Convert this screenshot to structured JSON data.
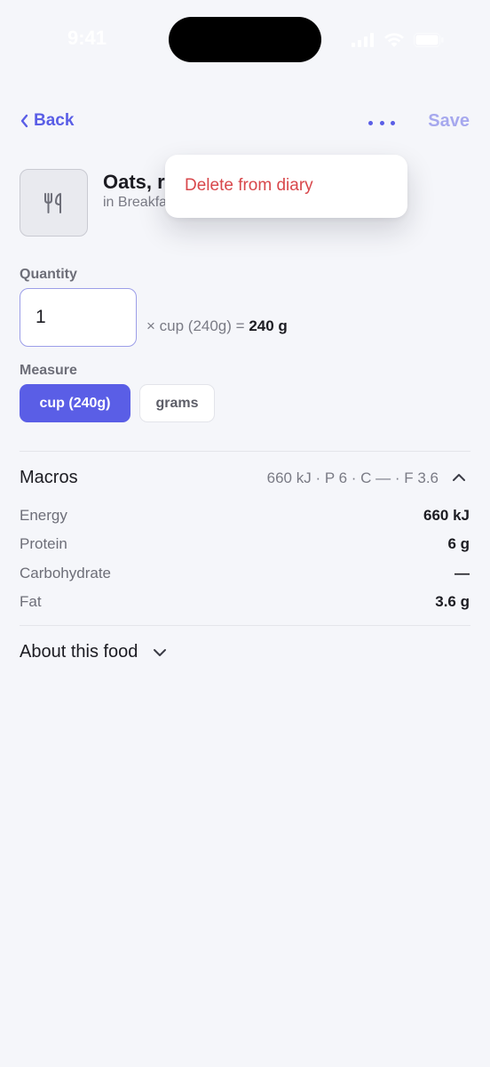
{
  "status_bar": {
    "time": "9:41"
  },
  "nav": {
    "back_label": "Back",
    "save_label": "Save"
  },
  "food": {
    "title": "Oats, r",
    "subtitle": "in Breakfa"
  },
  "menu": {
    "delete_label": "Delete from diary"
  },
  "quantity": {
    "label": "Quantity",
    "value": "1",
    "expr_prefix": "× cup (240g) =",
    "expr_total": "240 g"
  },
  "measure": {
    "label": "Measure",
    "options": [
      {
        "label": "cup (240g)",
        "selected": true
      },
      {
        "label": "grams",
        "selected": false
      }
    ]
  },
  "macros": {
    "title": "Macros",
    "summary": "660 kJ · P 6 · C — · F 3.6",
    "rows": [
      {
        "label": "Energy",
        "value": "660 kJ"
      },
      {
        "label": "Protein",
        "value": "6 g"
      },
      {
        "label": "Carbohydrate",
        "value": "—"
      },
      {
        "label": "Fat",
        "value": "3.6 g"
      }
    ]
  },
  "about": {
    "label": "About this food"
  },
  "colors": {
    "accent": "#5a5ee6",
    "accent_disabled": "#a6a8ee",
    "destructive": "#d8474b",
    "background": "#f5f6fa"
  },
  "icons": [
    "back-chevron-icon",
    "more-dots-icon",
    "utensils-icon",
    "chevron-up-icon",
    "chevron-down-icon",
    "signal-icon",
    "wifi-icon",
    "battery-icon"
  ]
}
